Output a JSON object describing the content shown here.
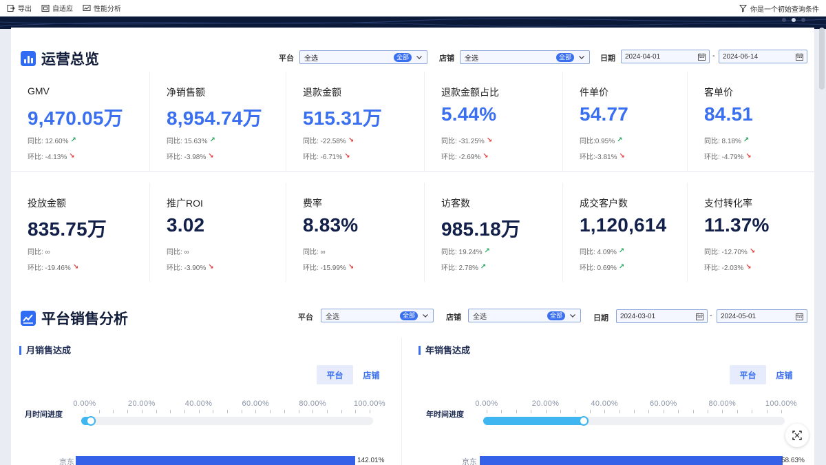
{
  "toolbar": {
    "export_label": "导出",
    "adaptive_label": "自适应",
    "perf_label": "性能分析",
    "query_label": "你是一个初始查询条件"
  },
  "overview": {
    "title": "运营总览",
    "platform_label": "平台",
    "platform_value": "全选",
    "platform_tag": "全部",
    "store_label": "店铺",
    "store_value": "全选",
    "store_tag": "全部",
    "date_label": "日期",
    "date_start": "2024-04-01",
    "date_end": "2024-06-14",
    "date_sep": "-"
  },
  "metrics_row1": [
    {
      "label": "GMV",
      "value": "9,470.05万",
      "yoy": "同比: 12.60%",
      "yoy_dir": "up",
      "mom": "环比: -4.13%",
      "mom_dir": "down"
    },
    {
      "label": "净销售额",
      "value": "8,954.74万",
      "yoy": "同比: 15.63%",
      "yoy_dir": "up",
      "mom": "环比: -3.98%",
      "mom_dir": "down"
    },
    {
      "label": "退款金额",
      "value": "515.31万",
      "yoy": "同比: -22.58%",
      "yoy_dir": "down",
      "mom": "环比: -6.71%",
      "mom_dir": "down"
    },
    {
      "label": "退款金额占比",
      "value": "5.44%",
      "yoy": "同比: -31.25%",
      "yoy_dir": "down",
      "mom": "环比: -2.69%",
      "mom_dir": "down"
    },
    {
      "label": "件单价",
      "value": "54.77",
      "yoy": "同比:0.95%",
      "yoy_dir": "up",
      "mom": "环比:-3.81%",
      "mom_dir": "down"
    },
    {
      "label": "客单价",
      "value": "84.51",
      "yoy": "同比: 8.18%",
      "yoy_dir": "up",
      "mom": "环比: -4.79%",
      "mom_dir": "down"
    }
  ],
  "metrics_row2": [
    {
      "label": "投放金额",
      "value": "835.75万",
      "yoy": "同比: ∞",
      "yoy_dir": "",
      "mom": "环比: -19.46%",
      "mom_dir": "down"
    },
    {
      "label": "推广ROI",
      "value": "3.02",
      "yoy": "同比: ∞",
      "yoy_dir": "",
      "mom": "环比: -3.90%",
      "mom_dir": "down"
    },
    {
      "label": "费率",
      "value": "8.83%",
      "yoy": "同比: ∞",
      "yoy_dir": "",
      "mom": "环比: -15.99%",
      "mom_dir": "down"
    },
    {
      "label": "访客数",
      "value": "985.18万",
      "yoy": "同比: 19.24%",
      "yoy_dir": "up",
      "mom": "环比: 2.78%",
      "mom_dir": "up"
    },
    {
      "label": "成交客户数",
      "value": "1,120,614",
      "yoy": "同比: 4.09%",
      "yoy_dir": "up",
      "mom": "环比: 0.69%",
      "mom_dir": "up"
    },
    {
      "label": "支付转化率",
      "value": "11.37%",
      "yoy": "同比: -12.70%",
      "yoy_dir": "down",
      "mom": "环比: -2.03%",
      "mom_dir": "down"
    }
  ],
  "sales": {
    "title": "平台销售分析",
    "platform_label": "平台",
    "platform_value": "全选",
    "platform_tag": "全部",
    "store_label": "店铺",
    "store_value": "全选",
    "store_tag": "全部",
    "date_label": "日期",
    "date_start": "2024-03-01",
    "date_end": "2024-05-01",
    "date_sep": "-",
    "tab_platform": "平台",
    "tab_store": "店铺",
    "monthly": {
      "title": "月销售达成",
      "progress_label": "月时间进度",
      "progress": 0.05,
      "bar_category": "京东",
      "bar_value": "142.01%"
    },
    "yearly": {
      "title": "年销售达成",
      "progress_label": "年时间进度",
      "progress": 0.35,
      "bar_category": "京东",
      "bar_value": "58.63%"
    },
    "scale_labels": [
      "0.00%",
      "20.00%",
      "40.00%",
      "60.00%",
      "80.00%",
      "100.00%"
    ]
  },
  "colors": {
    "accent": "#3a6ff0",
    "progress": "#3fb6ef",
    "up": "#26a65b",
    "down": "#e23b3b",
    "bar": "#3560e8"
  }
}
